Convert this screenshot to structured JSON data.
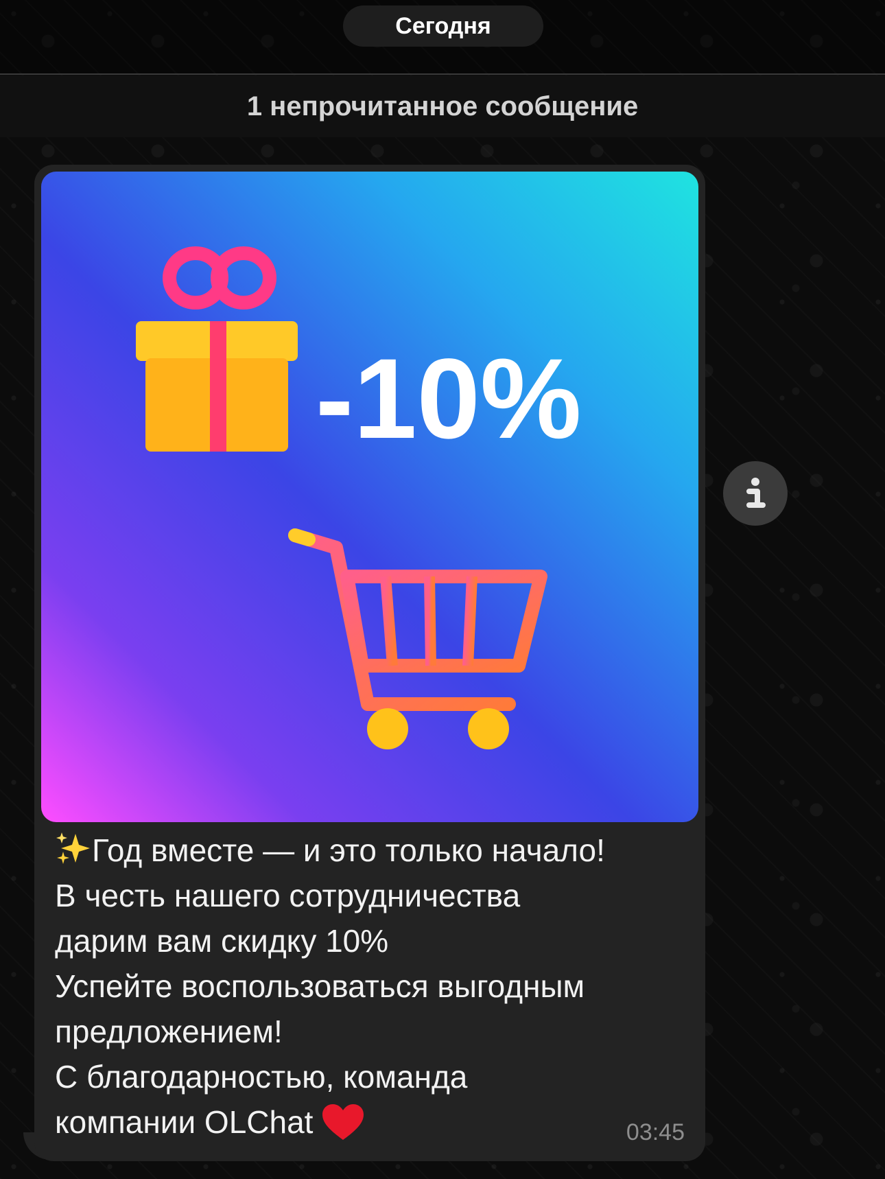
{
  "header": {
    "date_label": "Сегодня",
    "unread_label": "1 непрочитанное сообщение"
  },
  "message": {
    "image": {
      "discount_text": "-10%",
      "icons": [
        "gift-icon",
        "shopping-cart-icon"
      ],
      "gradient_colors": [
        "#1fe3e0",
        "#3b45e6",
        "#ff4dff"
      ]
    },
    "lines": [
      "Год вместе — и это только начало!",
      "В честь нашего сотрудничества",
      "дарим вам скидку 10%",
      "Успейте воспользоваться выгодным",
      "предложением!",
      "С благодарностью, команда",
      "компании OLChat"
    ],
    "time": "03:45"
  },
  "info_button": {
    "icon": "info-icon"
  },
  "colors": {
    "background": "#0c0c0c",
    "bubble": "#232323",
    "pill": "#1e1e1e",
    "text": "#f2f2f2",
    "time": "#8e8e8e"
  }
}
